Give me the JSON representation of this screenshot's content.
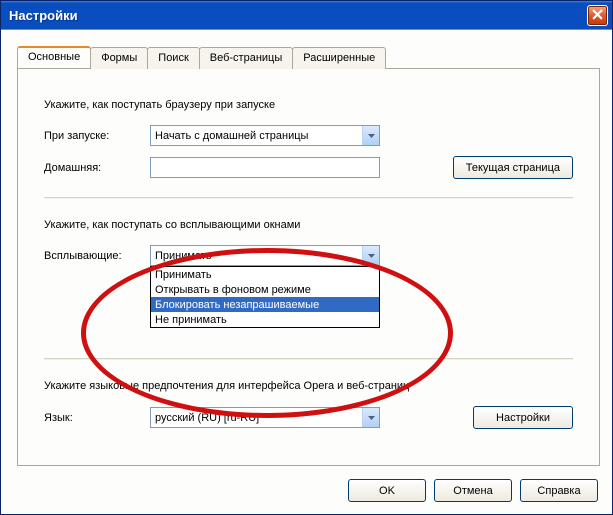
{
  "window": {
    "title": "Настройки"
  },
  "tabs": {
    "items": [
      {
        "label": "Основные"
      },
      {
        "label": "Формы"
      },
      {
        "label": "Поиск"
      },
      {
        "label": "Веб-страницы"
      },
      {
        "label": "Расширенные"
      }
    ]
  },
  "startup": {
    "section_label": "Укажите, как поступать браузеру при запуске",
    "onstart_label": "При запуске:",
    "onstart_value": "Начать с домашней страницы",
    "home_label": "Домашняя:",
    "home_value": "",
    "current_button": "Текущая страница"
  },
  "popups": {
    "section_label": "Укажите, как поступать со всплывающими окнами",
    "field_label": "Всплывающие:",
    "value": "Принимать",
    "options": [
      "Принимать",
      "Открывать в фоновом режиме",
      "Блокировать незапрашиваемые",
      "Не принимать"
    ]
  },
  "language": {
    "section_label": "Укажите языковые предпочтения для интерфейса Opera и веб-страниц",
    "field_label": "Язык:",
    "value": "русский (RU) [ru-RU]",
    "settings_button": "Настройки"
  },
  "buttons": {
    "ok": "OK",
    "cancel": "Отмена",
    "help": "Справка"
  }
}
